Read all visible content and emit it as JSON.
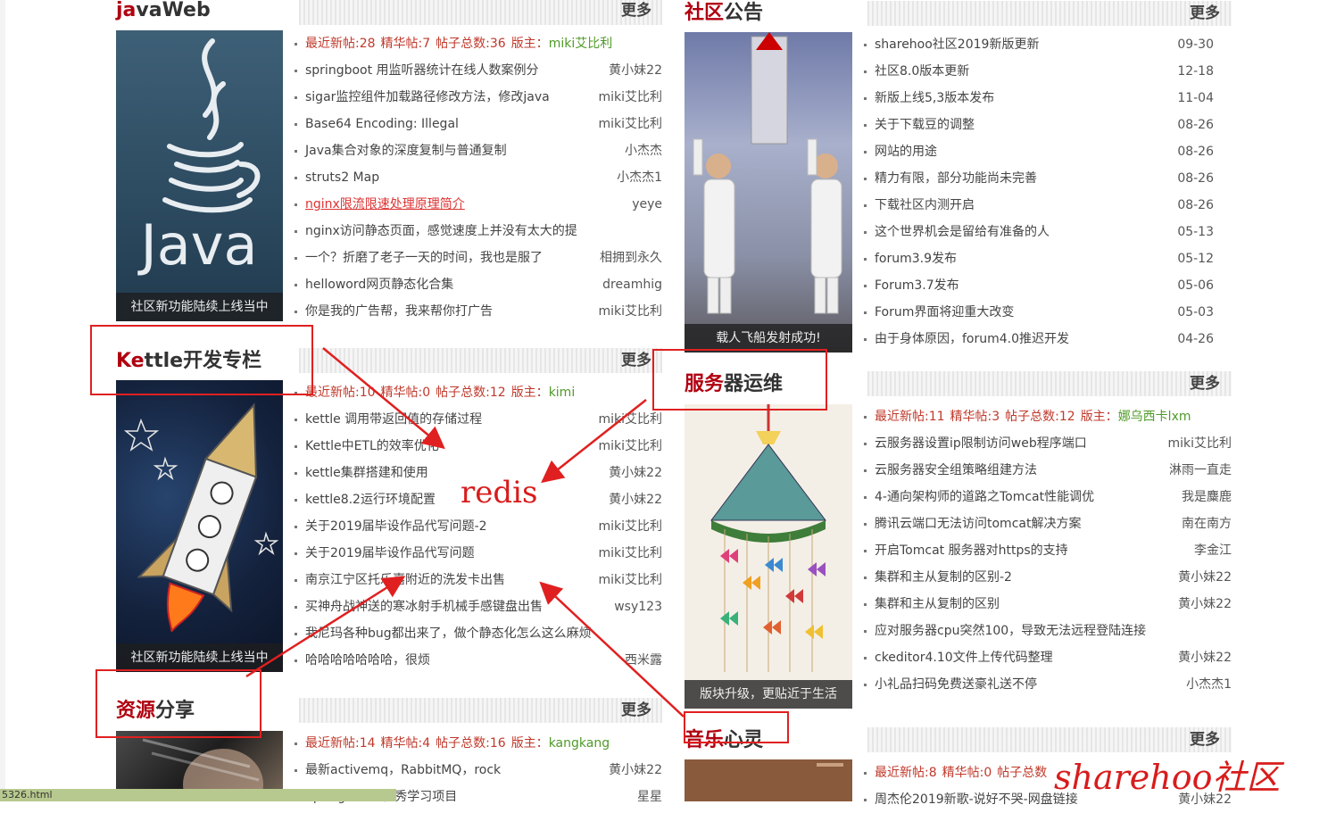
{
  "more_label": "更多",
  "colors": {
    "accent": "#b00010",
    "annotation": "#e02020",
    "author_green": "#4f9a28"
  },
  "annotation": {
    "redis": "redis",
    "watermark": "sharehoo社区"
  },
  "statusbar_text": "5326.html",
  "sections": {
    "javaweb": {
      "title_hl": "ja",
      "title_rest": "vaWeb",
      "caption": "社区新功能陆续上线当中",
      "image_icon": "java-logo",
      "stats": {
        "new": "最近新帖:28",
        "best": "精华帖:7",
        "total": "帖子总数:36",
        "mod_label": "版主：",
        "mod": "miki艾比利"
      },
      "posts": [
        {
          "title": "springboot 用监听器统计在线人数案例分",
          "author": "黄小妹22"
        },
        {
          "title": "sigar监控组件加载路径修改方法，修改java",
          "author": "miki艾比利"
        },
        {
          "title": "Base64 Encoding: Illegal",
          "author": "miki艾比利"
        },
        {
          "title": "Java集合对象的深度复制与普通复制",
          "author": "小杰杰"
        },
        {
          "title": "struts2 Map",
          "author": "小杰杰1"
        },
        {
          "title": "nginx限流限速处理原理简介",
          "author": "yeye",
          "highlight": true
        },
        {
          "title": "nginx访问静态页面，感觉速度上并没有太大的提",
          "author": ""
        },
        {
          "title": "一个？折磨了老子一天的时间，我也是服了",
          "author": "相拥到永久"
        },
        {
          "title": "helloword网页静态化合集",
          "author": "dreamhig"
        },
        {
          "title": "你是我的广告帮，我来帮你打广告",
          "author": "miki艾比利"
        }
      ]
    },
    "kettle": {
      "title_hl": "Ke",
      "title_rest": "ttle开发专栏",
      "caption": "社区新功能陆续上线当中",
      "image_icon": "rocket-illustration",
      "stats": {
        "new": "最近新帖:10",
        "best": "精华帖:0",
        "total": "帖子总数:12",
        "mod_label": "版主：",
        "mod": "kimi"
      },
      "posts": [
        {
          "title": "kettle 调用带返回值的存储过程",
          "author": "miki艾比利"
        },
        {
          "title": "Kettle中ETL的效率优化",
          "author": "miki艾比利"
        },
        {
          "title": "kettle集群搭建和使用",
          "author": "黄小妹22"
        },
        {
          "title": "kettle8.2运行环境配置",
          "author": "黄小妹22"
        },
        {
          "title": "关于2019届毕设作品代写问题-2",
          "author": "miki艾比利"
        },
        {
          "title": "关于2019届毕设作品代写问题",
          "author": "miki艾比利"
        },
        {
          "title": "南京江宁区托乐嘉附近的洗发卡出售",
          "author": "miki艾比利"
        },
        {
          "title": "买神舟战神送的寒冰射手机械手感键盘出售",
          "author": "wsy123"
        },
        {
          "title": "我尼玛各种bug都出来了，做个静态化怎么这么麻烦",
          "author": ""
        },
        {
          "title": "哈哈哈哈哈哈哈，很烦",
          "author": "西米露"
        }
      ]
    },
    "resource": {
      "title_hl": "资源",
      "title_rest": "分享",
      "stats": {
        "new": "最近新帖:14",
        "best": "精华帖:4",
        "total": "帖子总数:16",
        "mod_label": "版主：",
        "mod": "kangkang"
      },
      "posts": [
        {
          "title": "最新activemq，RabbitMQ，rock",
          "author": "黄小妹22"
        },
        {
          "title": "Spring Boot 优秀学习项目",
          "author": "星星"
        }
      ]
    },
    "notice": {
      "title_hl": "社区",
      "title_rest": "公告",
      "caption": "载人飞船发射成功!",
      "image_icon": "astronaut-photo",
      "posts": [
        {
          "title": "sharehoo社区2019新版更新",
          "date": "09-30"
        },
        {
          "title": "社区8.0版本更新",
          "date": "12-18"
        },
        {
          "title": "新版上线5,3版本发布",
          "date": "11-04"
        },
        {
          "title": "关于下载豆的调整",
          "date": "08-26"
        },
        {
          "title": "网站的用途",
          "date": "08-26"
        },
        {
          "title": "精力有限，部分功能尚未完善",
          "date": "08-26"
        },
        {
          "title": "下载社区内测开启",
          "date": "08-26"
        },
        {
          "title": "这个世界机会是留给有准备的人",
          "date": "05-13"
        },
        {
          "title": "forum3.9发布",
          "date": "05-12"
        },
        {
          "title": "Forum3.7发布",
          "date": "05-06"
        },
        {
          "title": "Forum界面将迎重大改变",
          "date": "05-03"
        },
        {
          "title": "由于身体原因，forum4.0推迟开发",
          "date": "04-26"
        }
      ]
    },
    "server": {
      "title_hl": "服务",
      "title_rest": "器运维",
      "caption": "版块升级，更贴近于生活",
      "image_icon": "butterfly-windchime-photo",
      "stats": {
        "new": "最近新帖:11",
        "best": "精华帖:3",
        "total": "帖子总数:12",
        "mod_label": "版主：",
        "mod": "娜乌西卡lxm"
      },
      "posts": [
        {
          "title": "云服务器设置ip限制访问web程序端口",
          "author": "miki艾比利"
        },
        {
          "title": "云服务器安全组策略组建方法",
          "author": "淋雨一直走"
        },
        {
          "title": "4-通向架构师的道路之Tomcat性能调优",
          "author": "我是麋鹿"
        },
        {
          "title": "腾讯云端口无法访问tomcat解决方案",
          "author": "南在南方"
        },
        {
          "title": "开启Tomcat 服务器对https的支持",
          "author": "李金江"
        },
        {
          "title": "集群和主从复制的区别-2",
          "author": "黄小妹22"
        },
        {
          "title": "集群和主从复制的区别",
          "author": "黄小妹22"
        },
        {
          "title": "应对服务器cpu突然100，导致无法远程登陆连接",
          "author": ""
        },
        {
          "title": "ckeditor4.10文件上传代码整理",
          "author": "黄小妹22"
        },
        {
          "title": "小礼品扫码免费送豪礼送不停",
          "author": "小杰杰1"
        }
      ]
    },
    "music": {
      "title_hl": "音乐",
      "title_rest": "心灵",
      "stats": {
        "new": "最近新帖:8",
        "best": "精华帖:0",
        "total": "帖子总数"
      },
      "posts": [
        {
          "title": "周杰伦2019新歌-说好不哭-网盘链接",
          "author": "黄小妹22"
        }
      ]
    }
  }
}
